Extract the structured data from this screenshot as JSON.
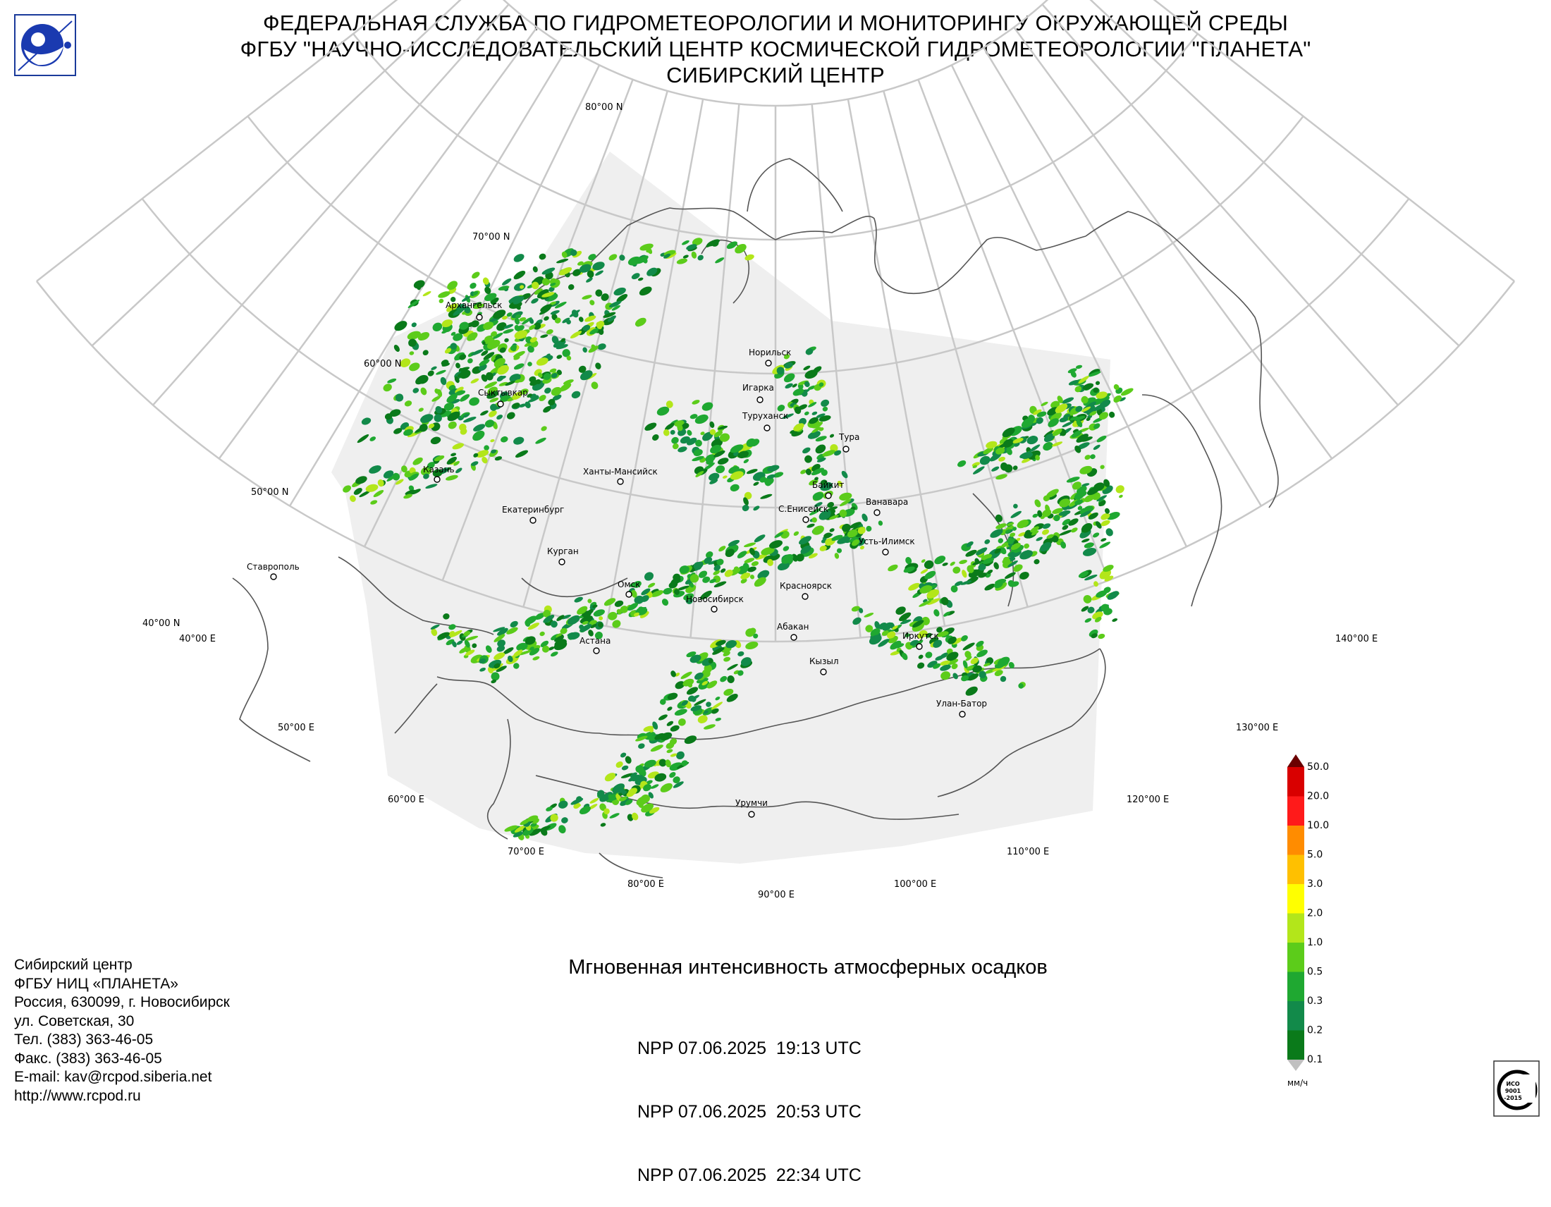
{
  "header": {
    "line1": "ФЕДЕРАЛЬНАЯ СЛУЖБА ПО ГИДРОМЕТЕОРОЛОГИИ И МОНИТОРИНГУ ОКРУЖАЮЩЕЙ СРЕДЫ",
    "line2": "ФГБУ \"НАУЧНО-ИССЛЕДОВАТЕЛЬСКИЙ ЦЕНТР КОСМИЧЕСКОЙ ГИДРОМЕТЕОРОЛОГИИ \"ПЛАНЕТА\"",
    "line3": "СИБИРСКИЙ ЦЕНТР"
  },
  "map": {
    "lat_labels": [
      "80°00 N",
      "70°00 N",
      "60°00 N",
      "50°00 N",
      "40°00 N"
    ],
    "lon_labels": [
      "40°00 E",
      "50°00 E",
      "60°00 E",
      "70°00 E",
      "80°00 E",
      "90°00 E",
      "100°00 E",
      "110°00 E",
      "120°00 E",
      "130°00 E",
      "140°00 E"
    ],
    "cities": [
      "Архангельск",
      "Сыктывкар",
      "Казань",
      "Ставрополь",
      "Екатеринбург",
      "Курган",
      "Ханты-Мансийск",
      "Омск",
      "Астана",
      "Новосибирск",
      "Красноярск",
      "Абакан",
      "Кызыл",
      "Норильск",
      "Игарка",
      "Туруханск",
      "Тура",
      "Байкит",
      "Ванавара",
      "С.Енисейск",
      "Усть-Илимск",
      "Иркутск",
      "Улан-Батор",
      "Урумчи"
    ],
    "colors": {
      "graticule": "#c8c8c8",
      "swath": "#efefef",
      "coast": "#555555"
    }
  },
  "legend": {
    "unit": "мм/ч",
    "labels": [
      "50.0",
      "20.0",
      "10.0",
      "5.0",
      "3.0",
      "2.0",
      "1.0",
      "0.5",
      "0.3",
      "0.2",
      "0.1"
    ],
    "colors": [
      "#b30000",
      "#d90000",
      "#ff1a1a",
      "#ff8c00",
      "#ffc000",
      "#ffff00",
      "#b3e61a",
      "#5ccc1a",
      "#1fa831",
      "#128a4a",
      "#0a7a1a"
    ],
    "top_color": "#6b0000",
    "bottom_color": "#c0c0c0"
  },
  "contacts": {
    "lines": [
      "Сибирский центр",
      "ФГБУ НИЦ «ПЛАНЕТА»",
      "Россия, 630099, г. Новосибирск",
      "ул. Советская, 30",
      "Тел. (383) 363-46-05",
      "Факс. (383) 363-46-05",
      "E-mail: kav@rcpod.siberia.net",
      "http://www.rcpod.ru"
    ]
  },
  "product": {
    "title": "Мгновенная интенсивность атмосферных осадков",
    "passes": [
      "NPP 07.06.2025  19:13 UTC",
      "NPP 07.06.2025  20:53 UTC",
      "NPP 07.06.2025  22:34 UTC"
    ]
  }
}
